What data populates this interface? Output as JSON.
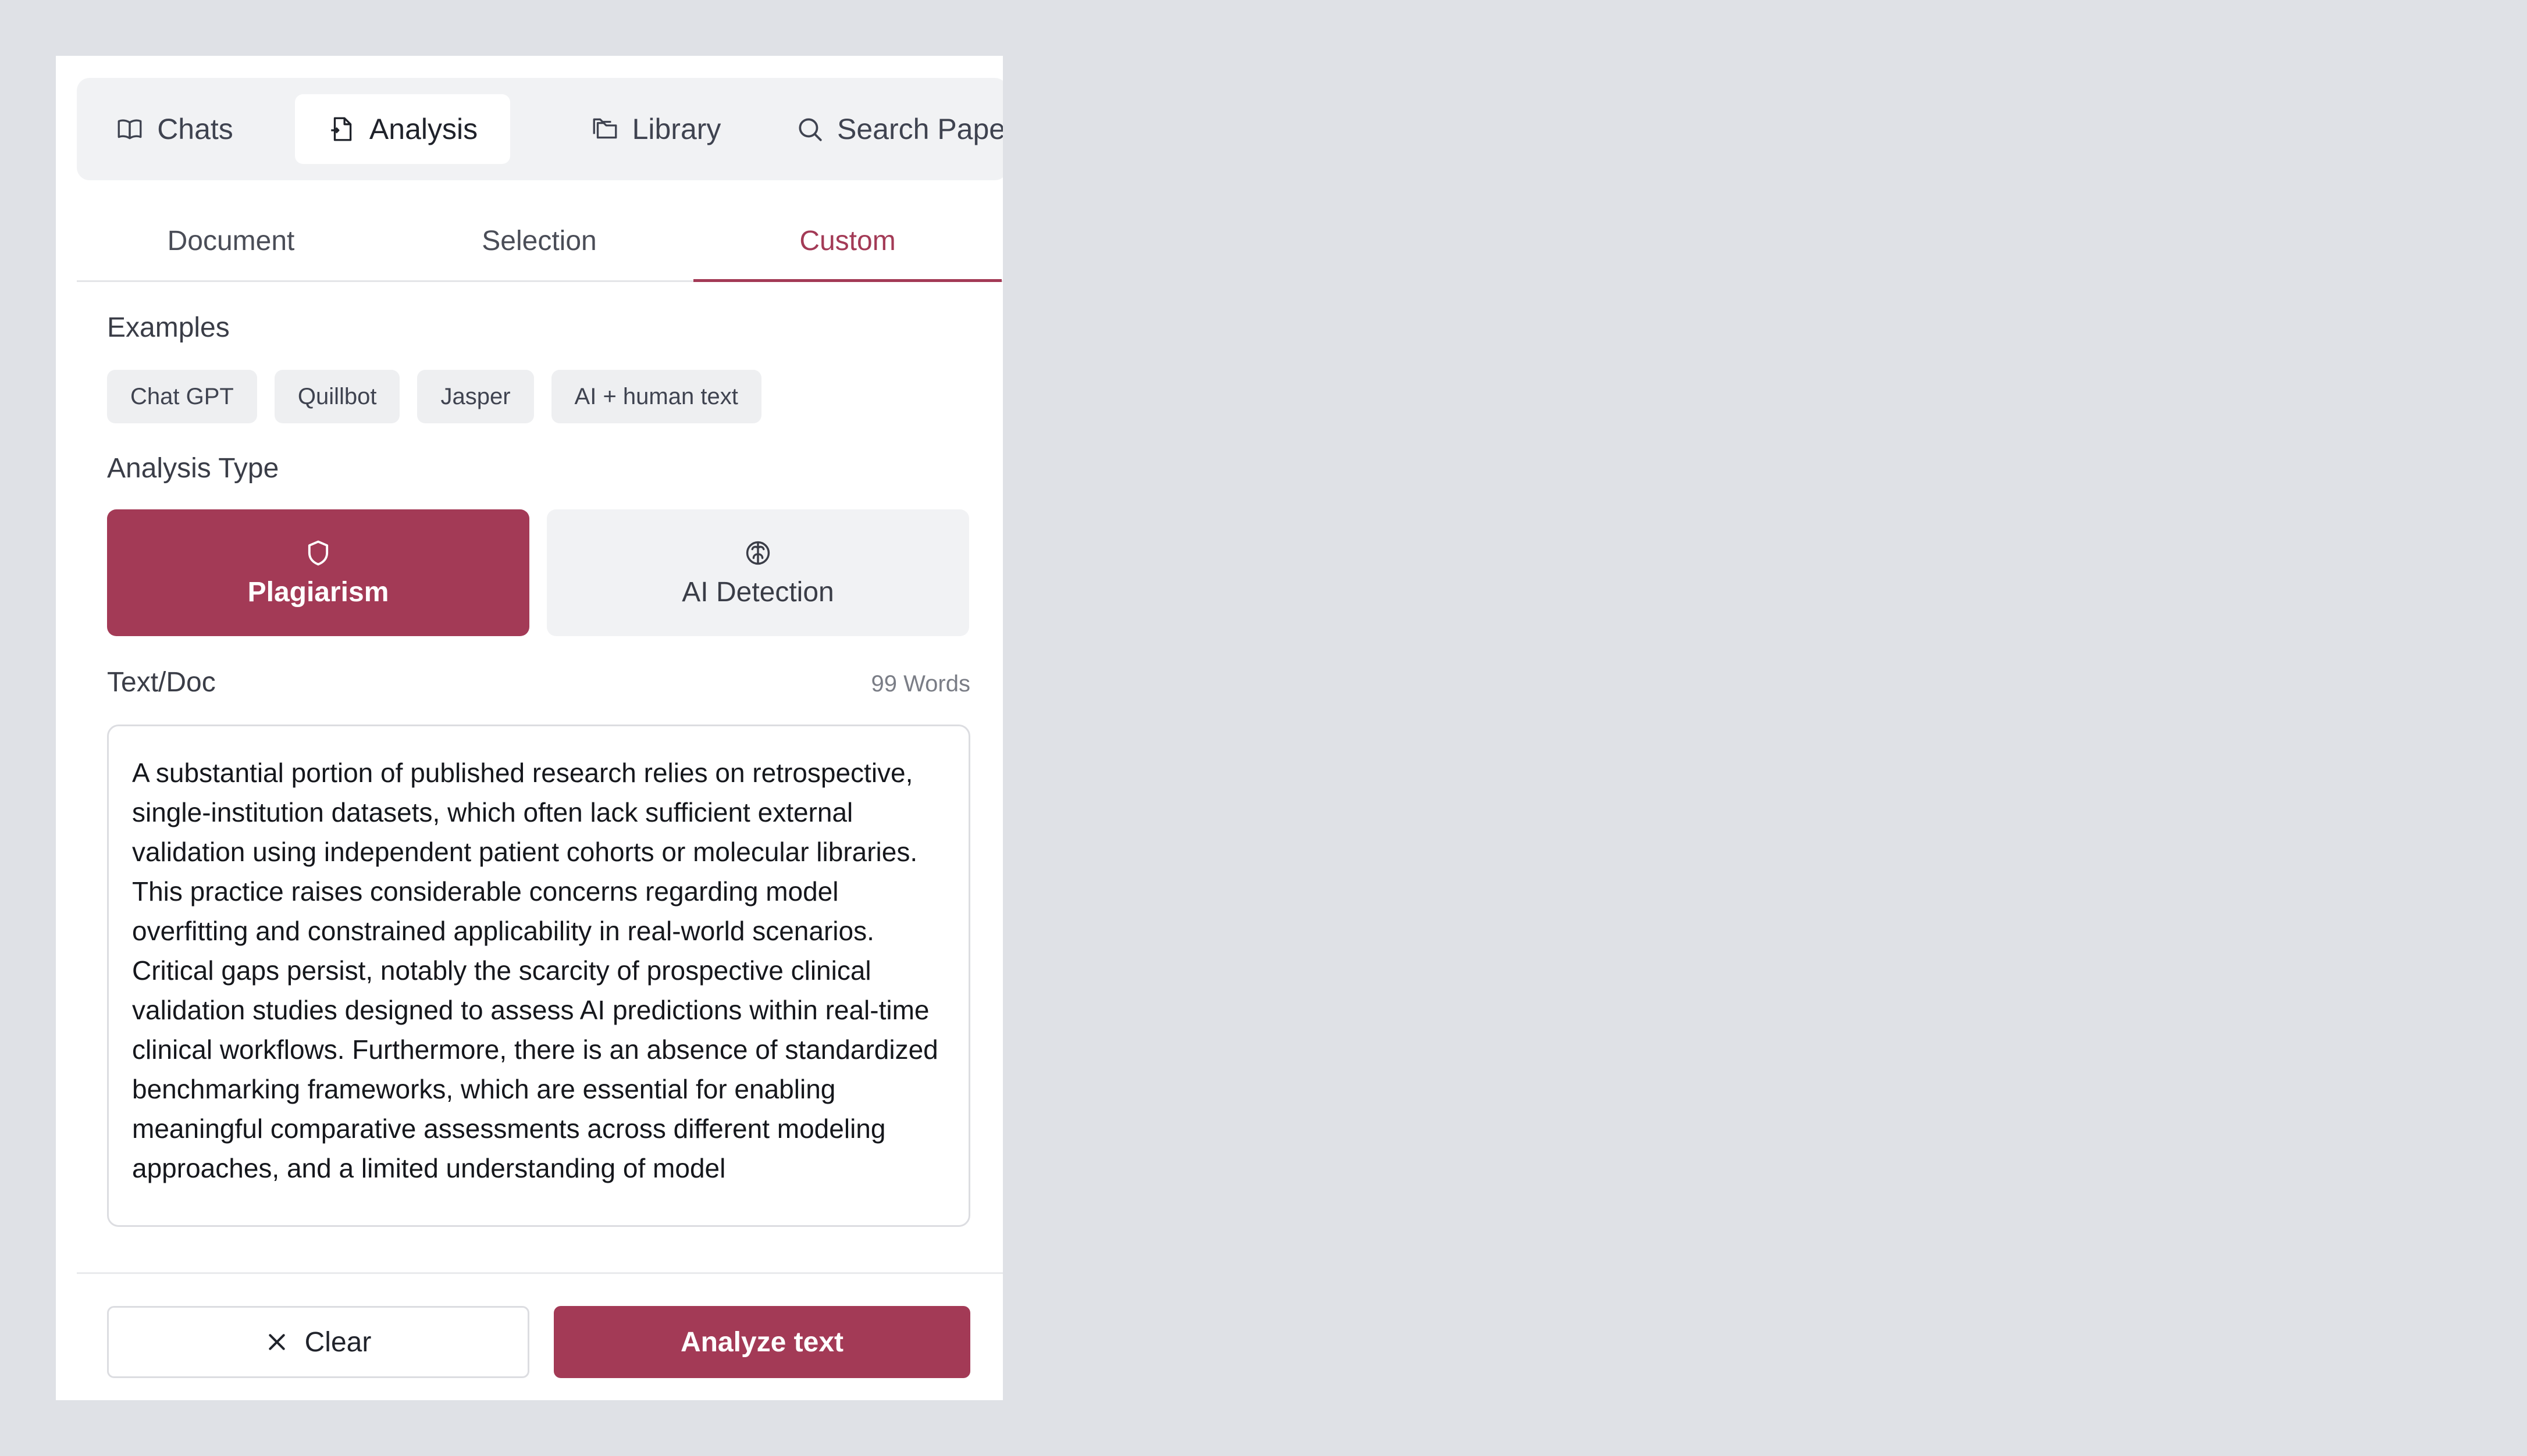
{
  "nav": {
    "tabs": [
      {
        "label": "Chats",
        "icon": "book-open-icon"
      },
      {
        "label": "Analysis",
        "icon": "document-icon",
        "active": true
      },
      {
        "label": "Library",
        "icon": "folders-icon"
      },
      {
        "label": "Search Pape",
        "icon": "search-icon"
      }
    ]
  },
  "subtabs": [
    {
      "label": "Document"
    },
    {
      "label": "Selection"
    },
    {
      "label": "Custom",
      "active": true
    }
  ],
  "examples": {
    "label": "Examples",
    "chips": [
      "Chat GPT",
      "Quillbot",
      "Jasper",
      "AI + human text"
    ]
  },
  "analysis_type": {
    "label": "Analysis Type",
    "options": [
      {
        "label": "Plagiarism",
        "icon": "shield-icon",
        "selected": true
      },
      {
        "label": "AI Detection",
        "icon": "brain-icon",
        "selected": false
      }
    ]
  },
  "text_doc": {
    "label": "Text/Doc",
    "word_count": "99 Words",
    "text": "A substantial portion of published research relies on retrospective, single-institution datasets, which often lack sufficient external validation using independent patient cohorts or molecular libraries. This practice raises considerable concerns regarding model overfitting and constrained applicability in real-world scenarios. Critical gaps persist, notably the scarcity of prospective clinical validation studies designed to assess AI predictions within real-time clinical workflows. Furthermore, there is an absence of standardized benchmarking frameworks, which are essential for enabling meaningful comparative assessments across different modeling approaches, and a limited understanding of model"
  },
  "actions": {
    "clear_label": "Clear",
    "analyze_label": "Analyze text"
  },
  "colors": {
    "accent": "#a33a56",
    "background": "#dfe1e6",
    "panel": "#ffffff"
  }
}
